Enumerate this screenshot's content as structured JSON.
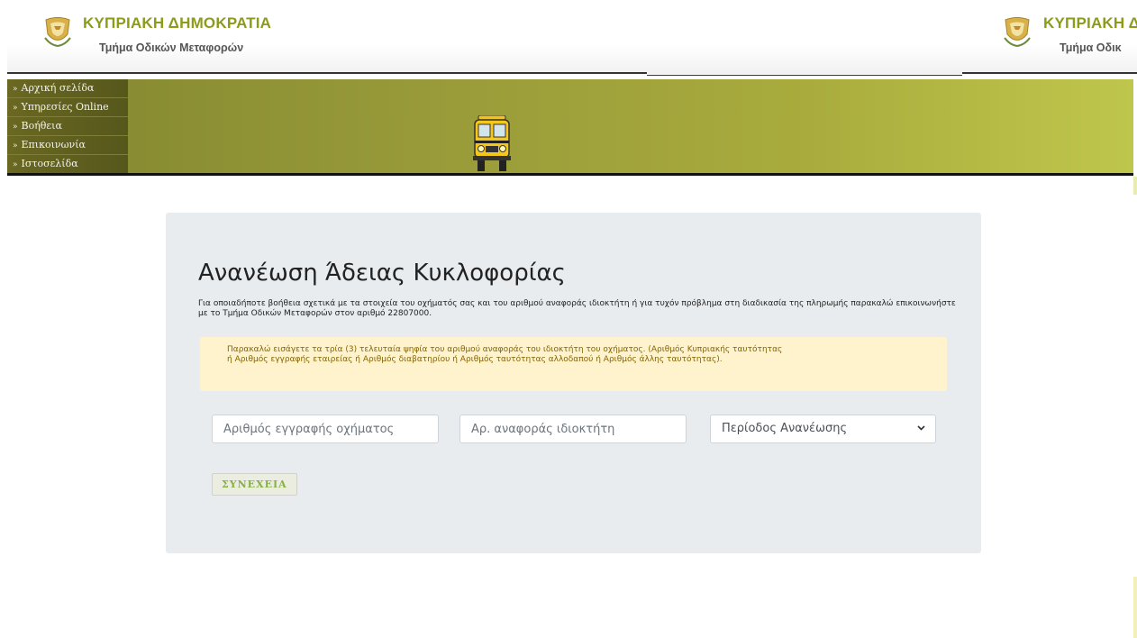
{
  "header": {
    "title": "ΚΥΠΡΙΑΚΗ ΔΗΜΟΚΡΑΤΙΑ",
    "subtitle": "Τμήμα Οδικών Μεταφορών",
    "title_truncated": "ΚΥΠΡΙΑΚΗ Δ",
    "subtitle_truncated": "Τμήμα Οδικ",
    "emblem_icon": "cyprus-coat-of-arms-icon"
  },
  "nav": {
    "items": [
      {
        "label": "Αρχική σελίδα"
      },
      {
        "label": "Υπηρεσίες Online"
      },
      {
        "label": "Βοήθεια"
      },
      {
        "label": "Επικοινωνία"
      },
      {
        "label": "Ιστοσελίδα"
      }
    ],
    "arrow_glyph": "»"
  },
  "banner": {
    "image_icon": "school-bus-icon"
  },
  "form": {
    "title": "Ανανέωση Άδειας Κυκλοφορίας",
    "intro": "Για οποιαδήποτε βοήθεια σχετικά με τα στοιχεία του οχήματός σας και του αριθμού αναφοράς ιδιοκτήτη ή για τυχόν πρόβλημα στη διαδικασία της πληρωμής παρακαλώ επικοινωνήστε με το Τμήμα Οδικών Μεταφορών στον αριθμό 22807000.",
    "alert": "Παρακαλώ εισάγετε τα τρία (3) τελευταία ψηφία του αριθμού αναφοράς του ιδιοκτήτη του οχήματος. (Αριθμός Κυπριακής ταυτότητας ή Αριθμός εγγραφής εταιρείας ή Αριθμός διαβατηρίου ή Αριθμός ταυτότητας αλλοδαπού ή Αριθμός άλλης ταυτότητας).",
    "registration_placeholder": "Αριθμός εγγραφής οχήματος",
    "registration_value": "",
    "owner_ref_placeholder": "Αρ. αναφοράς ιδιοκτήτη",
    "owner_ref_value": "",
    "period_selected": "Περίοδος Ανανέωσης",
    "submit_label": "ΣΥΝΕΧΕΙΑ"
  },
  "colors": {
    "brand_green": "#8d9b1b",
    "banner_olive": "#9a9c3a",
    "card_bg": "#e9ecef",
    "alert_bg": "#fff3cd",
    "alert_text": "#856404",
    "button_text": "#87b144"
  }
}
